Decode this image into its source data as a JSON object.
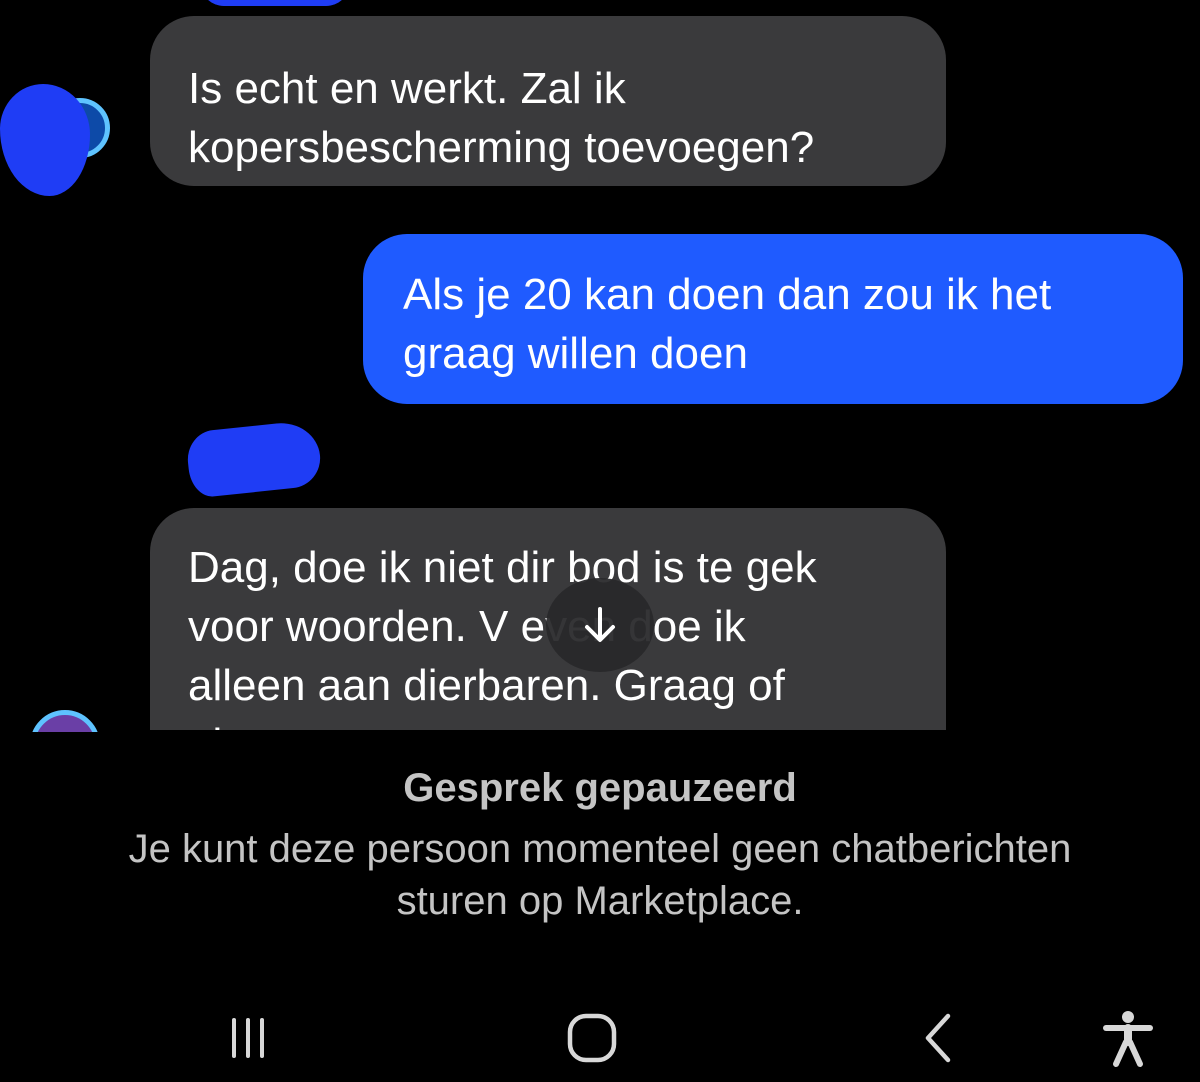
{
  "conversation": {
    "messages": [
      {
        "direction": "incoming",
        "lines": [
          "Is echt en werkt. Zal ik",
          "kopersbescherming toevoegen?"
        ]
      },
      {
        "direction": "outgoing",
        "lines": [
          "Als je 20 kan doen dan zou ik het",
          "graag willen doen"
        ]
      },
      {
        "direction": "incoming",
        "lines": [
          "Dag, doe ik niet dir bod is te gek",
          "voor woorden. V      even doe ik",
          "alleen aan dierbaren. Graag of",
          "niet"
        ]
      }
    ],
    "scroll_down_icon": "arrow-down-icon"
  },
  "paused_notice": {
    "title": "Gesprek gepauzeerd",
    "lines": [
      "Je kunt deze persoon momenteel geen chatberichten",
      "sturen op Marketplace."
    ]
  },
  "navbar": {
    "items": [
      "recent-apps-icon",
      "home-icon",
      "back-icon",
      "accessibility-icon"
    ],
    "icon_color": "#d8d8d8"
  },
  "colors": {
    "background": "#000000",
    "incoming_bubble": "#3a3a3c",
    "outgoing_bubble": "#1f5bff",
    "redaction": "#1f3df5",
    "notice_text": "#c4c4c4"
  }
}
